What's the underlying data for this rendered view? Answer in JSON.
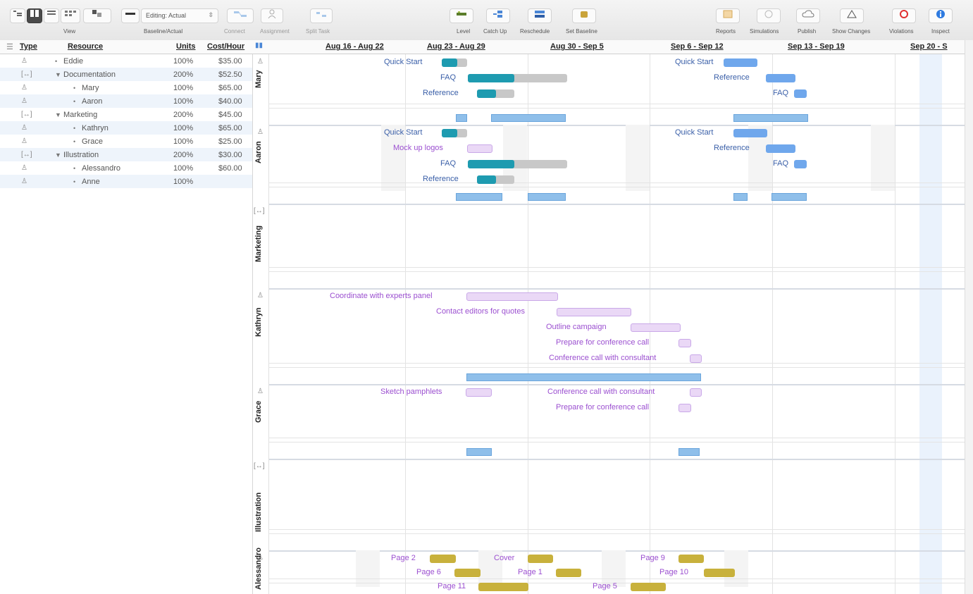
{
  "toolbar": {
    "groups": [
      {
        "label": "View"
      },
      {
        "label": "Baseline/Actual"
      },
      {
        "label": "Connect"
      },
      {
        "label": "Assignment"
      },
      {
        "label": "Split Task"
      },
      {
        "label": "Level"
      },
      {
        "label": "Catch Up"
      },
      {
        "label": "Reschedule"
      },
      {
        "label": "Set Baseline"
      },
      {
        "label": "Reports"
      },
      {
        "label": "Simulations"
      },
      {
        "label": "Publish"
      },
      {
        "label": "Show Changes"
      },
      {
        "label": "Violations"
      },
      {
        "label": "Inspect"
      }
    ],
    "editing_select": "Editing: Actual"
  },
  "table": {
    "headers": {
      "type": "Type",
      "resource": "Resource",
      "units": "Units",
      "cost": "Cost/Hour"
    },
    "rows": [
      {
        "kind": "person",
        "name": "Eddie",
        "indent": 0,
        "units": "100%",
        "cost": "$35.00"
      },
      {
        "kind": "group",
        "name": "Documentation",
        "indent": 0,
        "units": "200%",
        "cost": "$52.50"
      },
      {
        "kind": "person",
        "name": "Mary",
        "indent": 1,
        "units": "100%",
        "cost": "$65.00"
      },
      {
        "kind": "person",
        "name": "Aaron",
        "indent": 1,
        "units": "100%",
        "cost": "$40.00"
      },
      {
        "kind": "group",
        "name": "Marketing",
        "indent": 0,
        "units": "200%",
        "cost": "$45.00"
      },
      {
        "kind": "person",
        "name": "Kathryn",
        "indent": 1,
        "units": "100%",
        "cost": "$65.00"
      },
      {
        "kind": "person",
        "name": "Grace",
        "indent": 1,
        "units": "100%",
        "cost": "$25.00"
      },
      {
        "kind": "group",
        "name": "Illustration",
        "indent": 0,
        "units": "200%",
        "cost": "$30.00"
      },
      {
        "kind": "person",
        "name": "Alessandro",
        "indent": 1,
        "units": "100%",
        "cost": "$60.00"
      },
      {
        "kind": "person",
        "name": "Anne",
        "indent": 1,
        "units": "100%",
        "cost": ""
      }
    ]
  },
  "weeks": [
    "Aug 16 - Aug 22",
    "Aug 23 - Aug 29",
    "Aug 30 - Sep 5",
    "Sep 6 - Sep 12",
    "Sep 13 - Sep 19",
    "Sep 20 - S"
  ],
  "lanes": [
    {
      "name": "Mary",
      "kind": "person",
      "tasks": [
        {
          "label": "Quick Start",
          "style": "progress",
          "progress": 0.6
        },
        {
          "label": "FAQ",
          "style": "progress",
          "progress": 0.47
        },
        {
          "label": "Reference",
          "style": "progress",
          "progress": 0.5
        },
        {
          "label": "Quick Start",
          "style": "blue"
        },
        {
          "label": "Reference",
          "style": "blue"
        },
        {
          "label": "FAQ",
          "style": "blue"
        }
      ]
    },
    {
      "name": "Aaron",
      "kind": "person",
      "tasks": [
        {
          "label": "Quick Start",
          "style": "progress",
          "progress": 0.6
        },
        {
          "label": "Mock up logos",
          "style": "purple"
        },
        {
          "label": "FAQ",
          "style": "progress",
          "progress": 0.47
        },
        {
          "label": "Reference",
          "style": "progress",
          "progress": 0.5
        },
        {
          "label": "Quick Start",
          "style": "blue"
        },
        {
          "label": "Reference",
          "style": "blue"
        },
        {
          "label": "FAQ",
          "style": "blue"
        }
      ]
    },
    {
      "name": "Marketing",
      "kind": "group",
      "tasks": []
    },
    {
      "name": "Kathryn",
      "kind": "person",
      "tasks": [
        {
          "label": "Coordinate with experts panel",
          "style": "purple"
        },
        {
          "label": "Contact editors for quotes",
          "style": "purple"
        },
        {
          "label": "Outline campaign",
          "style": "purple"
        },
        {
          "label": "Prepare for conference call",
          "style": "purple"
        },
        {
          "label": "Conference call with consultant",
          "style": "purple"
        }
      ]
    },
    {
      "name": "Grace",
      "kind": "person",
      "tasks": [
        {
          "label": "Sketch pamphlets",
          "style": "purple"
        },
        {
          "label": "Conference call with consultant",
          "style": "purple"
        },
        {
          "label": "Prepare for conference call",
          "style": "purple"
        }
      ]
    },
    {
      "name": "Illustration",
      "kind": "group",
      "tasks": []
    },
    {
      "name": "Alessandro",
      "kind": "person",
      "tasks": [
        {
          "label": "Page 2",
          "style": "gold"
        },
        {
          "label": "Cover",
          "style": "gold"
        },
        {
          "label": "Page 9",
          "style": "gold"
        },
        {
          "label": "Page 6",
          "style": "gold"
        },
        {
          "label": "Page 1",
          "style": "gold"
        },
        {
          "label": "Page 10",
          "style": "gold"
        },
        {
          "label": "Page 11",
          "style": "gold"
        },
        {
          "label": "Page 5",
          "style": "gold"
        }
      ]
    }
  ],
  "colors": {
    "teal": "#1e9bb0",
    "gray": "#c8c8c8",
    "blue": "#6fa7ec",
    "purple_fill": "#ead8f6",
    "purple_border": "#c9a8e8",
    "purple_text": "#9b4fd0",
    "gold": "#c8b13c",
    "task_text_blue": "#3a5fa8"
  }
}
